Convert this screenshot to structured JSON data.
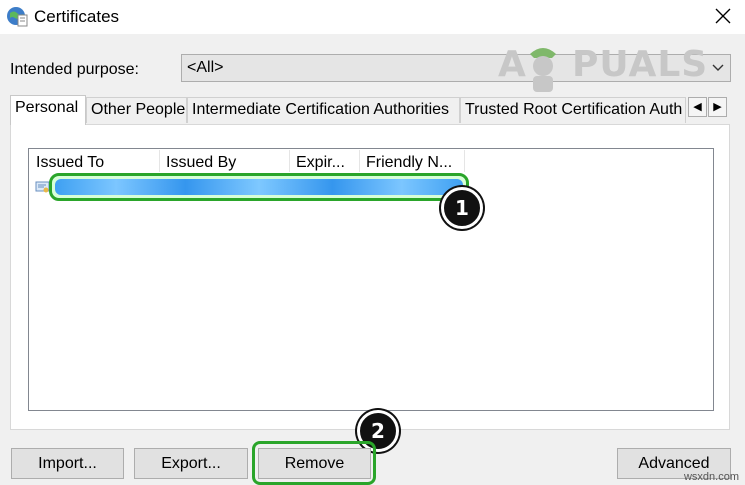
{
  "window": {
    "title": "Certificates"
  },
  "purpose": {
    "label": "Intended purpose:",
    "value": "<All>"
  },
  "watermark": {
    "text_left": "A",
    "text_right": "PUALS"
  },
  "tabs": [
    {
      "label": "Personal",
      "active": true
    },
    {
      "label": "Other People",
      "active": false
    },
    {
      "label": "Intermediate Certification Authorities",
      "active": false
    },
    {
      "label": "Trusted Root Certification Auth",
      "active": false
    }
  ],
  "list": {
    "columns": [
      "Issued To",
      "Issued By",
      "Expir...",
      "Friendly N..."
    ]
  },
  "badges": {
    "one": "1",
    "two": "2"
  },
  "buttons": {
    "import": "Import...",
    "export": "Export...",
    "remove": "Remove",
    "advanced": "Advanced"
  },
  "footer_watermark": "wsxdn.com",
  "colors": {
    "highlight": "#2aa52a",
    "badge": "#111111",
    "selection": "#3596ee"
  }
}
